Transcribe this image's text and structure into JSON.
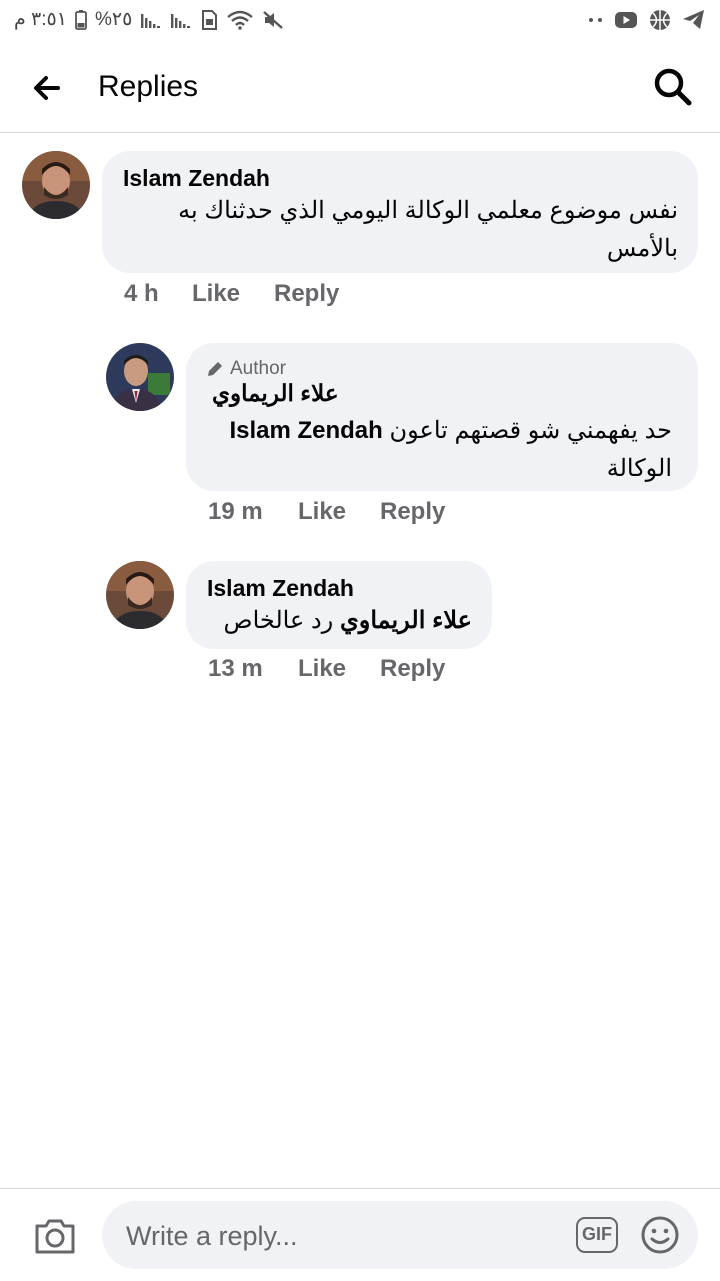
{
  "status_bar": {
    "time": "٣:٥١ م",
    "battery": "%٢٥"
  },
  "header": {
    "title": "Replies"
  },
  "comments": [
    {
      "author": "Islam Zendah",
      "text": "نفس موضوع معلمي الوكالة اليومي الذي حدثناك به بالأمس",
      "time": "4 h",
      "like": "Like",
      "reply": "Reply"
    },
    {
      "badge": "Author",
      "author": "علاء الريماوي",
      "text_prefix": "حد يفهمني شو قصتهم تاعون",
      "mention": "Islam Zendah",
      "text_suffix": "الوكالة",
      "time": "19 m",
      "like": "Like",
      "reply": "Reply"
    },
    {
      "author": "Islam Zendah",
      "mention": "علاء الريماوي",
      "text": "رد عالخاص",
      "time": "13 m",
      "like": "Like",
      "reply": "Reply"
    }
  ],
  "footer": {
    "placeholder": "Write a reply...",
    "gif_label": "GIF"
  },
  "colors": {
    "bubble": "#f0f2f5",
    "meta": "#65676b",
    "text": "#050505"
  }
}
